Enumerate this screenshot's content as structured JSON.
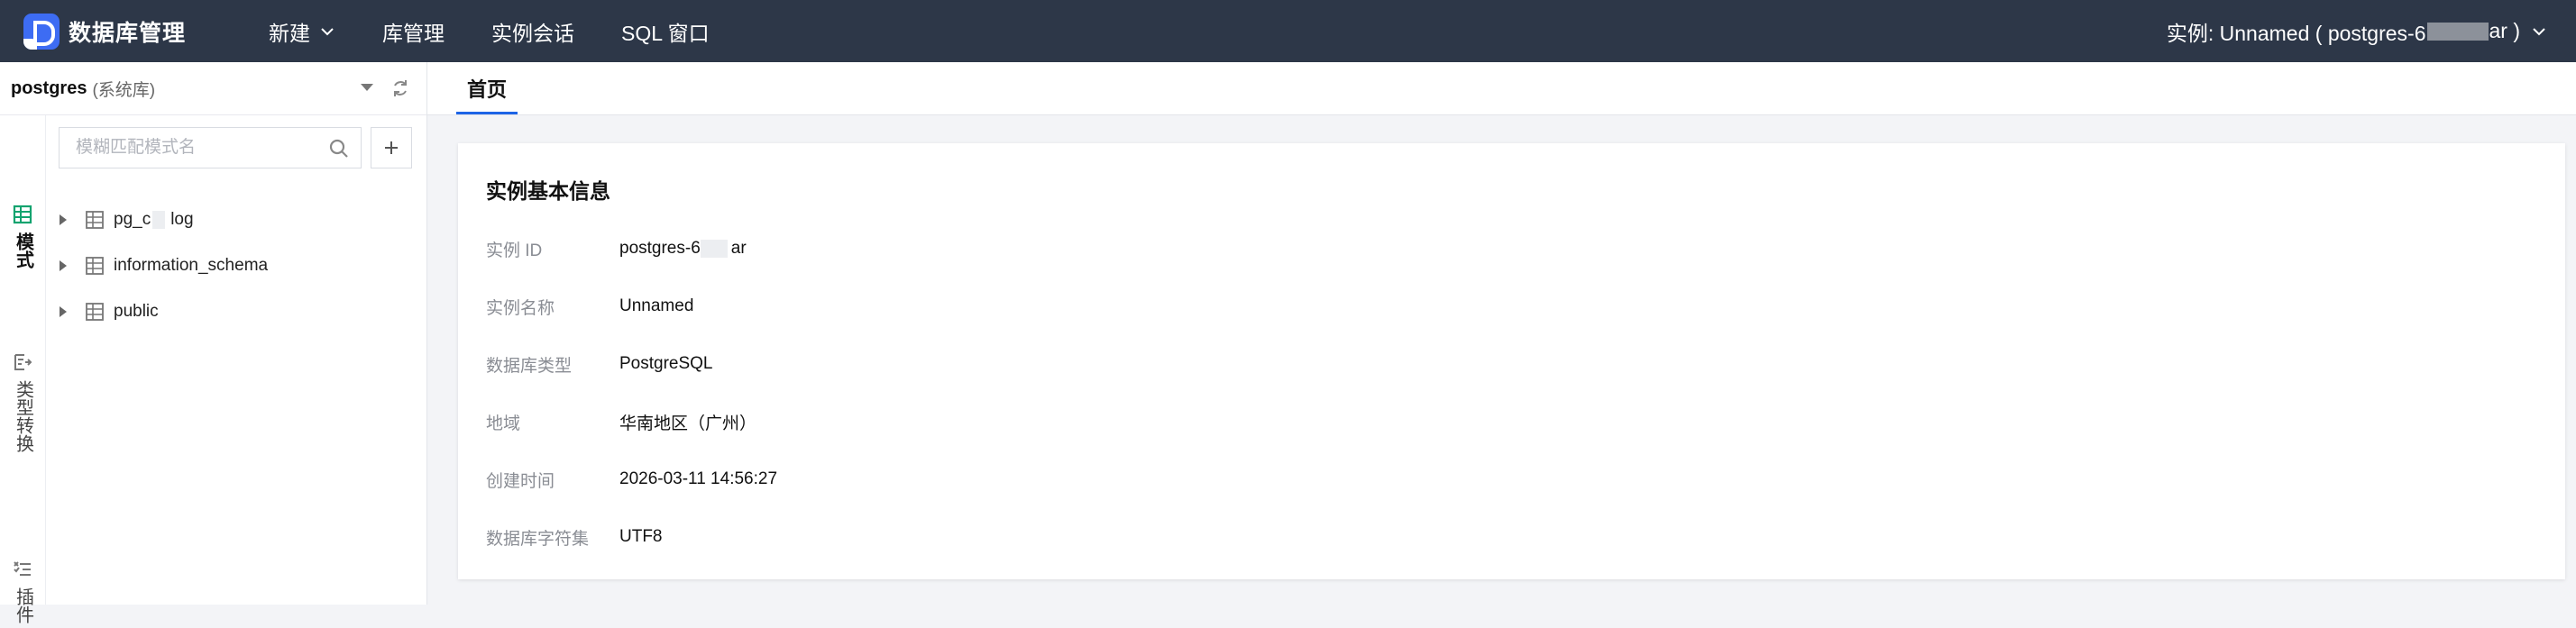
{
  "header": {
    "app_title": "数据库管理",
    "nav": [
      "新建",
      "库管理",
      "实例会话",
      "SQL 窗口"
    ],
    "instance_prefix": "实例: Unnamed ( postgres-6",
    "instance_suffix": "ar )"
  },
  "sidebar": {
    "db_name": "postgres",
    "db_tag": "(系统库)",
    "tabs": [
      "模式",
      "类型转换",
      "插件"
    ],
    "search_placeholder": "模糊匹配模式名",
    "schemas": [
      {
        "prefix": "pg_c",
        "suffix": "log"
      },
      {
        "label": "information_schema"
      },
      {
        "label": "public"
      }
    ]
  },
  "main": {
    "tab_home": "首页",
    "card": {
      "title": "实例基本信息",
      "instance_id_prefix": "postgres-6",
      "instance_id_suffix": "ar",
      "rows": [
        {
          "label": "实例 ID"
        },
        {
          "label": "实例名称",
          "value": "Unnamed"
        },
        {
          "label": "数据库类型",
          "value": "PostgreSQL"
        },
        {
          "label": "地域",
          "value": "华南地区（广州）"
        },
        {
          "label": "创建时间",
          "value": "2026-03-11 14:56:27"
        },
        {
          "label": "数据库字符集",
          "value": "UTF8"
        }
      ]
    }
  },
  "colors": {
    "topbar": "#2d3748",
    "accent": "#1d64e6",
    "schema_tab": "#12a36f"
  },
  "icons": [
    "logo-icon",
    "chevron-down-icon",
    "refresh-icon",
    "table-icon",
    "type-convert-icon",
    "plugin-icon",
    "search-icon",
    "plus-icon",
    "caret-right-icon"
  ]
}
